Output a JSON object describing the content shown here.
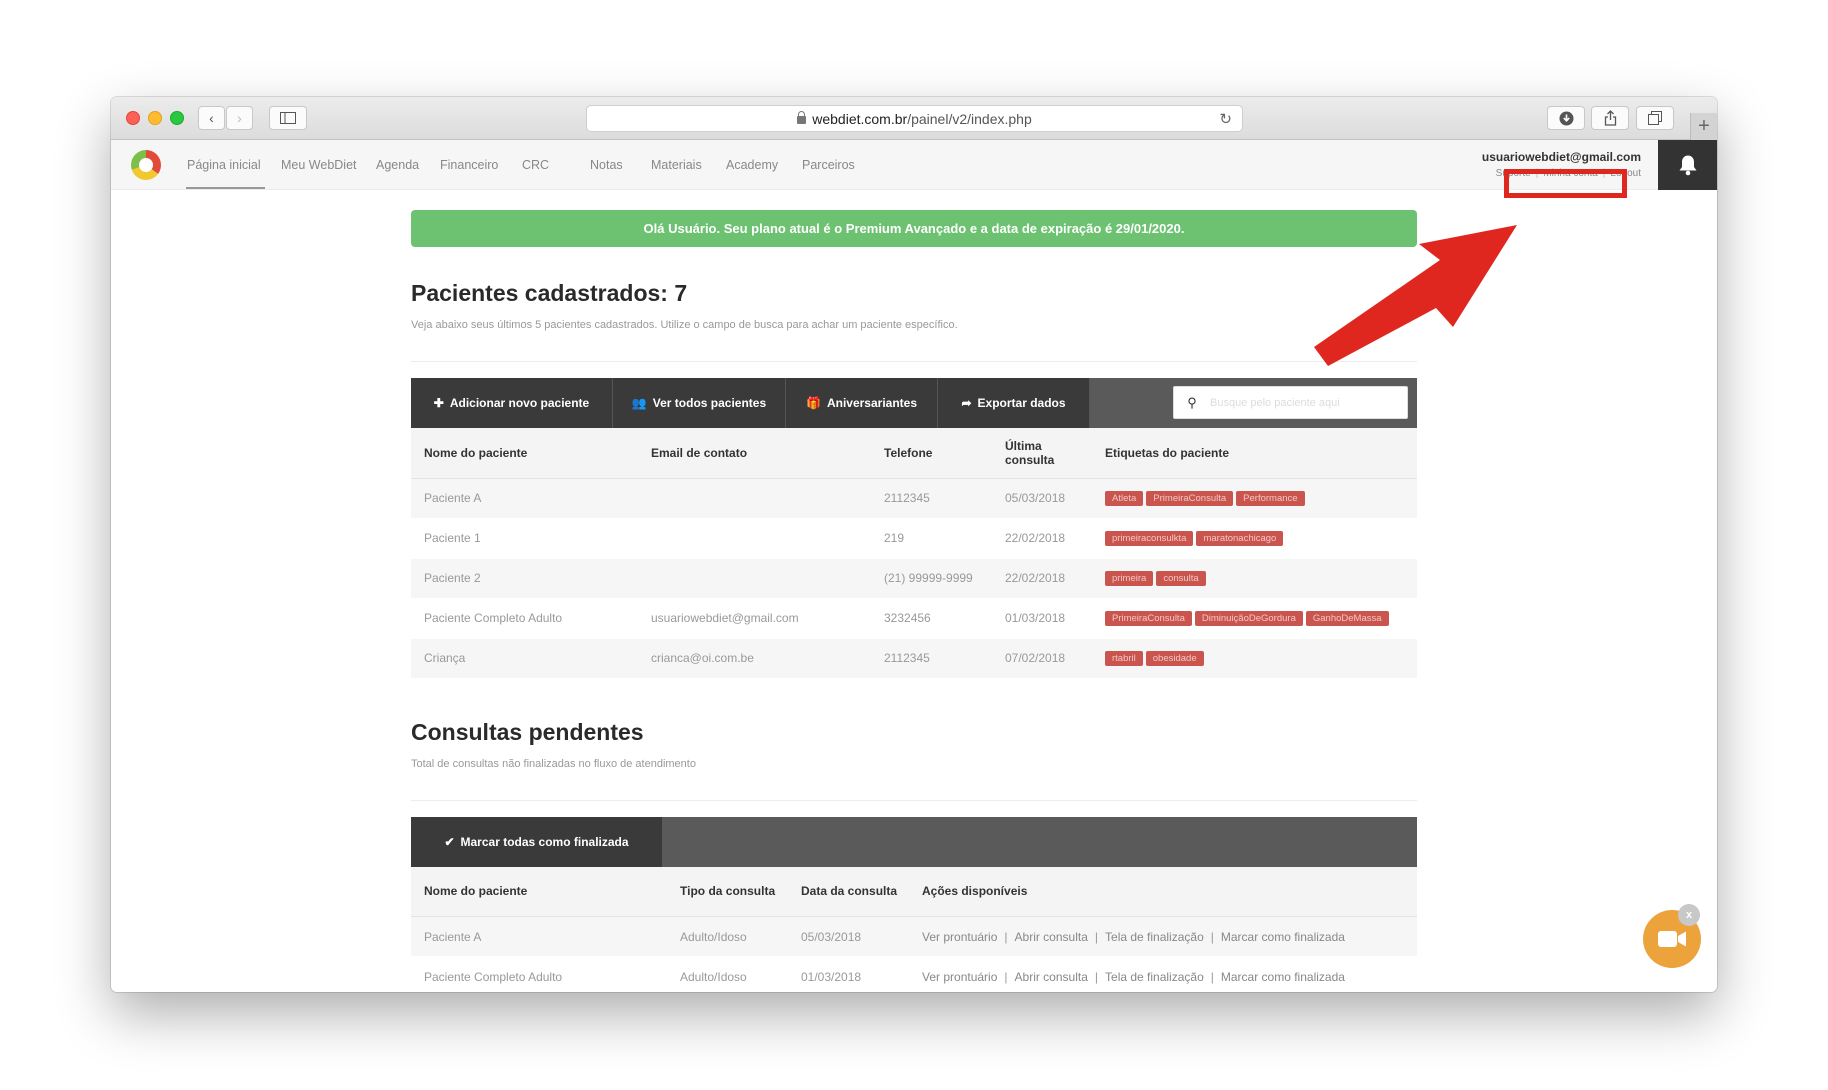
{
  "browser": {
    "url_host": "webdiet.com.br",
    "url_path": "/painel/v2/index.php"
  },
  "nav": {
    "items": [
      "Página inicial",
      "Meu WebDiet",
      "Agenda",
      "Financeiro",
      "CRC",
      "Notas",
      "Materiais",
      "Academy",
      "Parceiros"
    ],
    "user_email": "usuariowebdiet@gmail.com",
    "links": [
      "Suporte",
      "Minha conta",
      "Logout"
    ]
  },
  "alert": "Olá Usuário. Seu plano atual é o Premium Avançado e a data de expiração é 29/01/2020.",
  "patients": {
    "title": "Pacientes cadastrados: 7",
    "subtitle": "Veja abaixo seus últimos 5 pacientes cadastrados. Utilize o campo de busca para achar um paciente específico.",
    "buttons": {
      "add": "Adicionar novo paciente",
      "view_all": "Ver todos pacientes",
      "birthdays": "Aniversariantes",
      "export": "Exportar dados"
    },
    "search_placeholder": "Busque pelo paciente aqui",
    "columns": [
      "Nome do paciente",
      "Email de contato",
      "Telefone",
      "Última consulta",
      "Etiquetas do paciente"
    ],
    "rows": [
      {
        "name": "Paciente A",
        "email": "",
        "phone": "2112345",
        "last": "05/03/2018",
        "tags": [
          "Atleta",
          "PrimeiraConsulta",
          "Performance"
        ]
      },
      {
        "name": "Paciente 1",
        "email": "",
        "phone": "219",
        "last": "22/02/2018",
        "tags": [
          "primeiraconsulkta",
          "maratonachicago"
        ]
      },
      {
        "name": "Paciente 2",
        "email": "",
        "phone": "(21) 99999-9999",
        "last": "22/02/2018",
        "tags": [
          "primeira",
          "consulta"
        ]
      },
      {
        "name": "Paciente Completo Adulto",
        "email": "usuariowebdiet@gmail.com",
        "phone": "3232456",
        "last": "01/03/2018",
        "tags": [
          "PrimeiraConsulta",
          "DiminuiçãoDeGordura",
          "GanhoDeMassa"
        ]
      },
      {
        "name": "Criança",
        "email": "crianca@oi.com.be",
        "phone": "2112345",
        "last": "07/02/2018",
        "tags": [
          "rtabril",
          "obesidade"
        ]
      }
    ]
  },
  "pending": {
    "title": "Consultas pendentes",
    "subtitle": "Total de consultas não finalizadas no fluxo de atendimento",
    "mark_all": "Marcar todas como finalizada",
    "columns": [
      "Nome do paciente",
      "Tipo da consulta",
      "Data da consulta",
      "Ações disponíveis"
    ],
    "actions": [
      "Ver prontuário",
      "Abrir consulta",
      "Tela de finalização",
      "Marcar como finalizada"
    ],
    "rows": [
      {
        "name": "Paciente A",
        "type": "Adulto/Idoso",
        "date": "05/03/2018"
      },
      {
        "name": "Paciente Completo Adulto",
        "type": "Adulto/Idoso",
        "date": "01/03/2018"
      }
    ]
  },
  "widget": {
    "close": "x"
  },
  "colors": {
    "alert": "#6cc270",
    "tag": "#c9554e",
    "annotation": "#e0271f",
    "video_widget": "#eda33c"
  }
}
